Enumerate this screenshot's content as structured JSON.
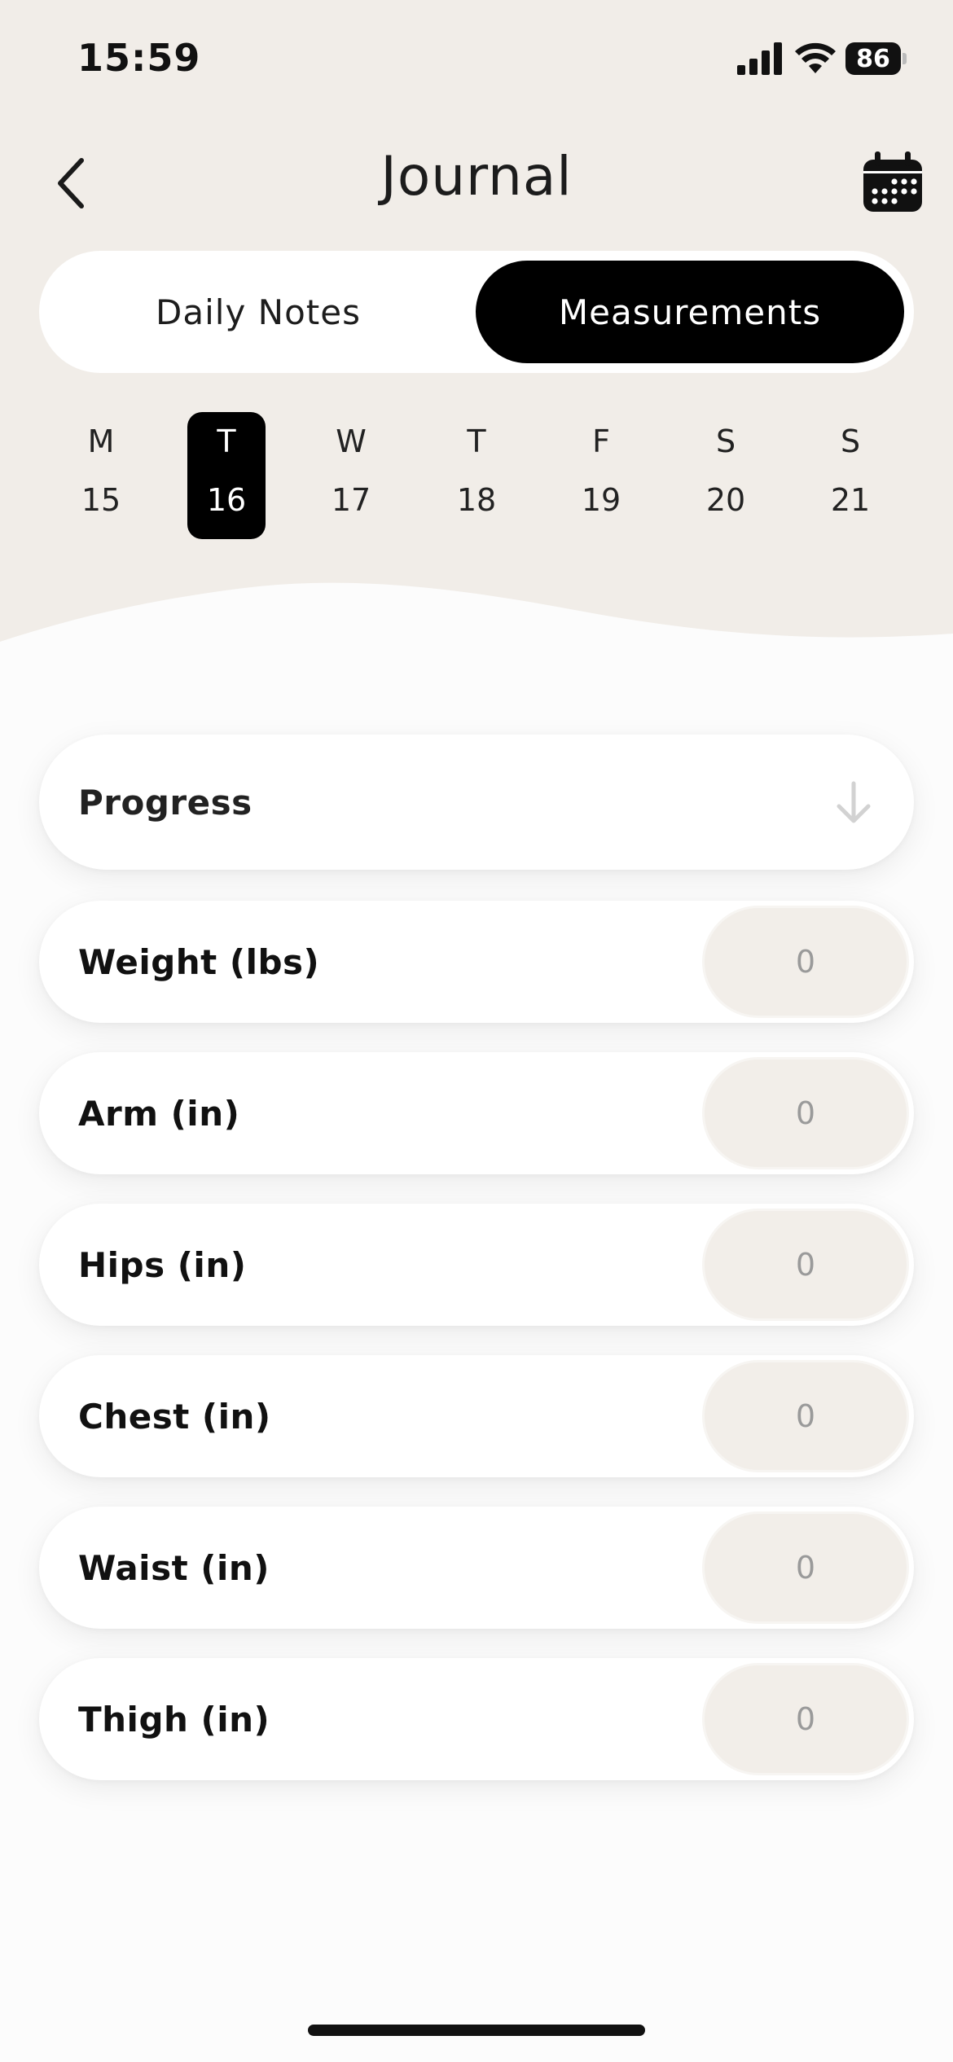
{
  "status_bar": {
    "time": "15:59",
    "battery": "86"
  },
  "header": {
    "title": "Journal"
  },
  "tabs": [
    {
      "label": "Daily Notes",
      "selected": false
    },
    {
      "label": "Measurements",
      "selected": true
    }
  ],
  "week": [
    {
      "dow": "M",
      "date": "15"
    },
    {
      "dow": "T",
      "date": "16"
    },
    {
      "dow": "W",
      "date": "17"
    },
    {
      "dow": "T",
      "date": "18"
    },
    {
      "dow": "F",
      "date": "19"
    },
    {
      "dow": "S",
      "date": "20"
    },
    {
      "dow": "S",
      "date": "21"
    }
  ],
  "selected_day_index": 1,
  "progress": {
    "label": "Progress"
  },
  "measurements": [
    {
      "label": "Weight (lbs)",
      "value": "0"
    },
    {
      "label": "Arm (in)",
      "value": "0"
    },
    {
      "label": "Hips (in)",
      "value": "0"
    },
    {
      "label": "Chest (in)",
      "value": "0"
    },
    {
      "label": "Waist (in)",
      "value": "0"
    },
    {
      "label": "Thigh (in)",
      "value": "0"
    }
  ],
  "colors": {
    "header_background": "#f1ede8",
    "page_background": "#fcfcfc",
    "accent": "#000000",
    "field_background": "#f2eee9"
  }
}
